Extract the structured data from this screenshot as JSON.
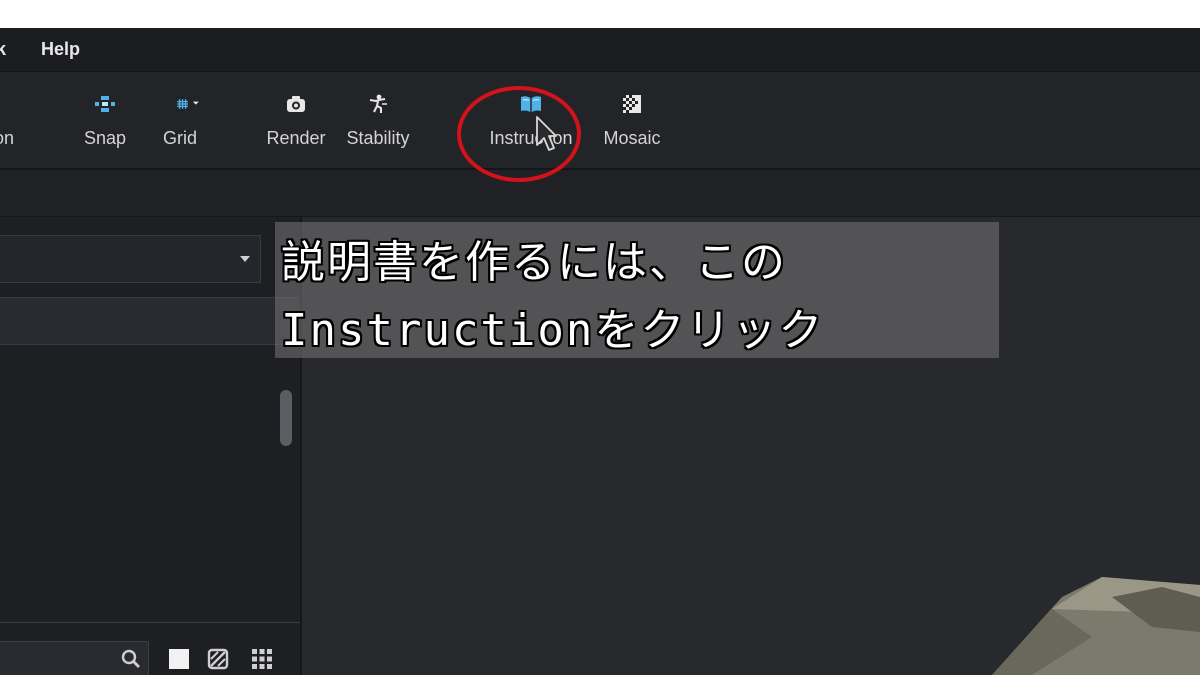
{
  "menu": {
    "partial_item": "k",
    "help_label": "Help"
  },
  "toolbar": {
    "partial_label": "on",
    "snap_label": "Snap",
    "grid_label": "Grid",
    "render_label": "Render",
    "stability_label": "Stability",
    "instruction_label": "Instruction",
    "mosaic_label": "Mosaic"
  },
  "caption": {
    "line1": "説明書を作るには、この",
    "line2": "Instructionをクリック"
  },
  "colors": {
    "accent_icon": "#4fb3e8",
    "highlight_circle": "#d3121b",
    "background": "#26272c"
  },
  "icons": {
    "snap": "snap-icon",
    "grid": "grid-icon",
    "render": "camera-icon",
    "stability": "stability-figure-icon",
    "instruction": "open-book-icon",
    "mosaic": "mosaic-icon",
    "search": "search-icon"
  }
}
